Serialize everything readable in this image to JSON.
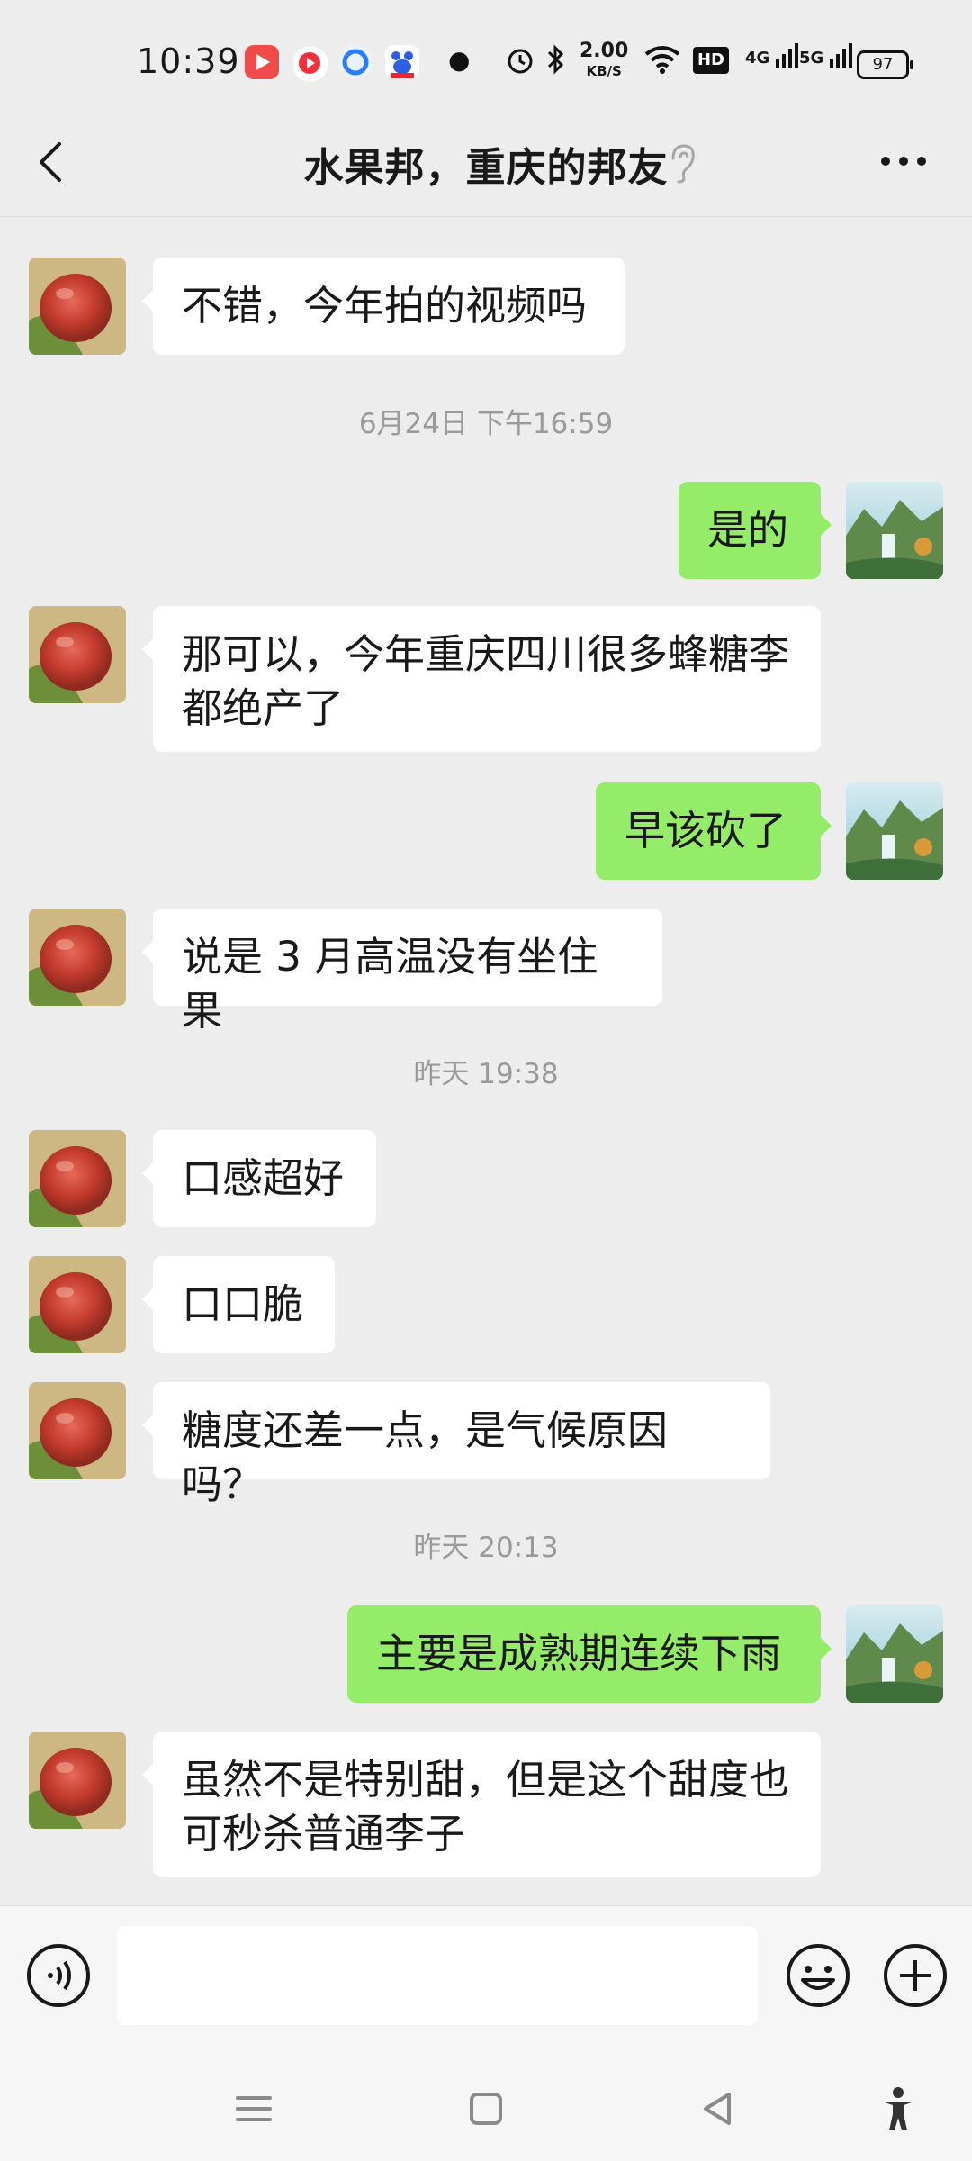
{
  "status_bar": {
    "time": "10:39",
    "net_speed_value": "2.00",
    "net_speed_unit": "KB/S",
    "hd": "HD",
    "signal1": "4G",
    "signal2": "5G",
    "battery": "97",
    "icons": [
      "video-app-icon",
      "music-app-icon",
      "browser-icon",
      "baidu-icon",
      "dot-icon",
      "alarm-icon",
      "bluetooth-icon",
      "wifi-icon"
    ]
  },
  "header": {
    "title": "水果邦，重庆的邦友",
    "icons": [
      "back-icon",
      "ear-icon",
      "more-icon"
    ]
  },
  "messages": [
    {
      "side": "left",
      "text": "不错，今年拍的视频吗"
    },
    {
      "time": "6月24日 下午16:59"
    },
    {
      "side": "right",
      "text": "是的"
    },
    {
      "side": "left",
      "text": "那可以，今年重庆四川很多蜂糖李\n都绝产了"
    },
    {
      "side": "right",
      "text": "早该砍了"
    },
    {
      "side": "left",
      "text": "说是 3 月高温没有坐住果"
    },
    {
      "time": "昨天 19:38"
    },
    {
      "side": "left",
      "text": "口感超好"
    },
    {
      "side": "left",
      "text": "口口脆"
    },
    {
      "side": "left",
      "text": "糖度还差一点，是气候原因吗？"
    },
    {
      "time": "昨天 20:13"
    },
    {
      "side": "right",
      "text": "主要是成熟期连续下雨"
    },
    {
      "side": "left",
      "text": "虽然不是特别甜，但是这个甜度也\n可秒杀普通李子"
    }
  ],
  "input_bar": {
    "text_value": "",
    "icons": [
      "voice-icon",
      "emoji-icon",
      "plus-icon"
    ]
  },
  "system_nav": {
    "icons": [
      "menu-icon",
      "home-icon",
      "back-triangle-icon",
      "accessibility-icon"
    ]
  },
  "colors": {
    "background": "#ededed",
    "bubble_self": "#95ec69",
    "bubble_other": "#ffffff",
    "timestamp": "#9a9a9a"
  }
}
